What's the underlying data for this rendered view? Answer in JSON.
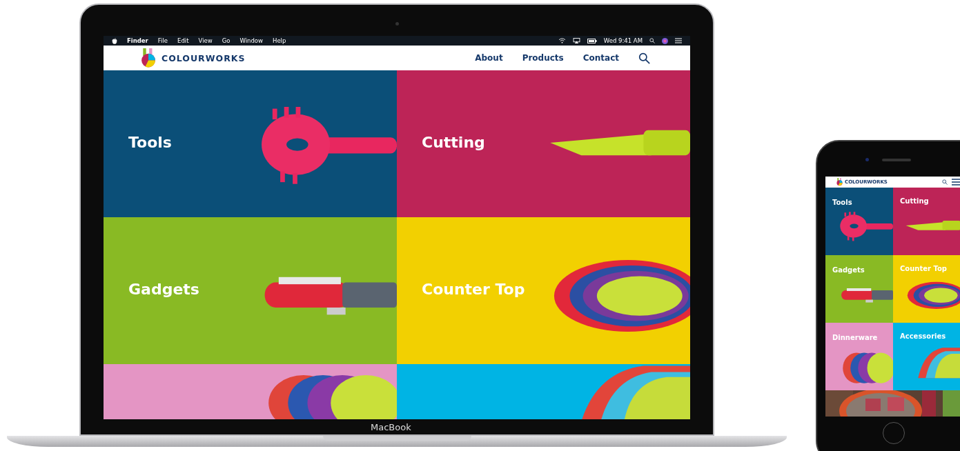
{
  "laptop": {
    "menu_bar": {
      "app": "Finder",
      "menus": [
        "File",
        "Edit",
        "View",
        "Go",
        "Window",
        "Help"
      ],
      "clock": "Wed 9:41 AM"
    },
    "site": {
      "brand": "COLOURWORKS",
      "nav": [
        "About",
        "Products",
        "Contact"
      ],
      "tiles": [
        {
          "label": "Tools",
          "kind": "picture"
        },
        {
          "label": "Cutting",
          "kind": "picture"
        },
        {
          "label": "Gadgets",
          "kind": "picture"
        },
        {
          "label": "Counter Top",
          "kind": "picture"
        },
        {
          "kind": "picture"
        },
        {
          "kind": "picture"
        }
      ]
    },
    "model": "MacBook"
  },
  "phone": {
    "site": {
      "brand": "COLOURWORKS",
      "tiles": [
        {
          "label": "Tools",
          "kind": "picture"
        },
        {
          "label": "Cutting",
          "kind": "picture"
        },
        {
          "label": "Gadgets",
          "kind": "picture"
        },
        {
          "label": "Counter Top",
          "kind": "picture"
        },
        {
          "label": "Dinnerware",
          "kind": "picture"
        },
        {
          "label": "Accessories",
          "kind": "picture"
        }
      ]
    }
  }
}
